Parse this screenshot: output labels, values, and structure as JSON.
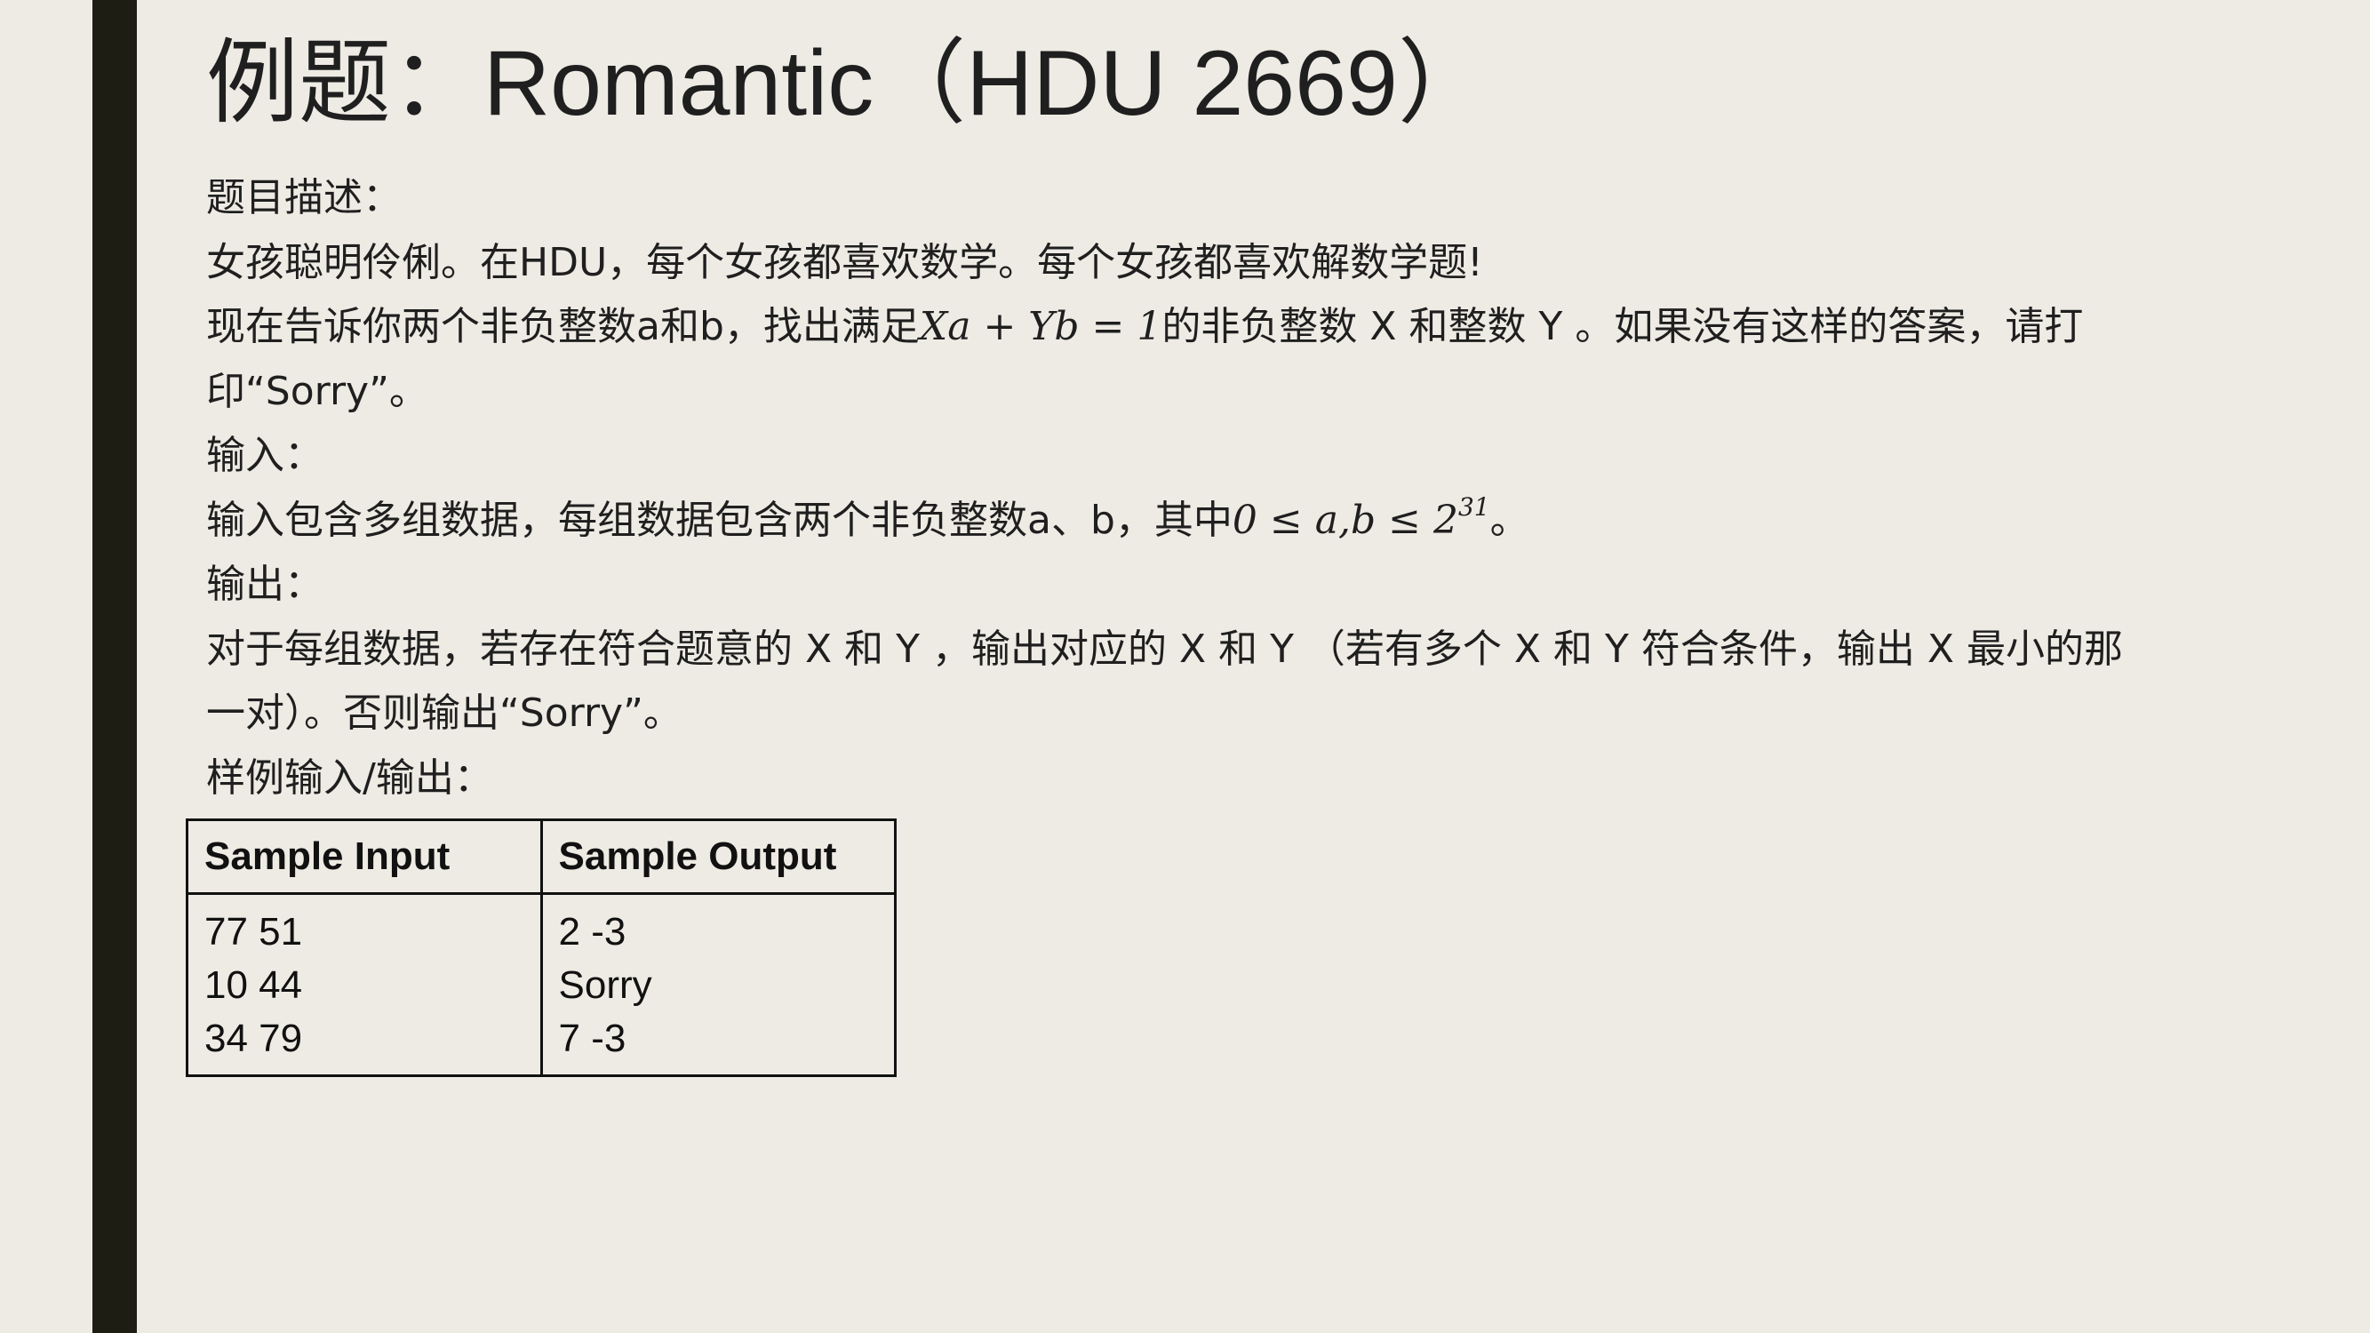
{
  "slide": {
    "title": "例题：Romantic（HDU 2669）",
    "section_description_label": "题目描述：",
    "description_line1": "女孩聪明伶俐。在HDU，每个女孩都喜欢数学。每个女孩都喜欢解数学题!",
    "description_line2_prefix": "现在告诉你两个非负整数a和b，找出满足",
    "description_line2_equation": "Xa + Yb = 1",
    "description_line2_suffix": "的非负整数 X 和整数 Y 。如果没有这样的答案，请打",
    "description_line3": "印“Sorry”。",
    "section_input_label": "输入：",
    "input_text_prefix": "输入包含多组数据，每组数据包含两个非负整数a、b，其中",
    "input_constraint_base": "0 ≤ a,b ≤ 2",
    "input_constraint_exponent": "31",
    "input_text_suffix": "。",
    "section_output_label": "输出：",
    "output_line1": "对于每组数据，若存在符合题意的 X 和 Y ，输出对应的 X 和 Y （若有多个 X 和 Y 符合条件，输出 X 最小的那",
    "output_line2": "一对）。否则输出“Sorry”。",
    "section_sample_label": "样例输入/输出：",
    "sample_table": {
      "headers": [
        "Sample Input",
        "Sample Output"
      ],
      "input_lines": [
        "77 51",
        "10 44",
        "34 79"
      ],
      "output_lines": [
        "2 -3",
        "Sorry",
        "7 -3"
      ]
    }
  }
}
